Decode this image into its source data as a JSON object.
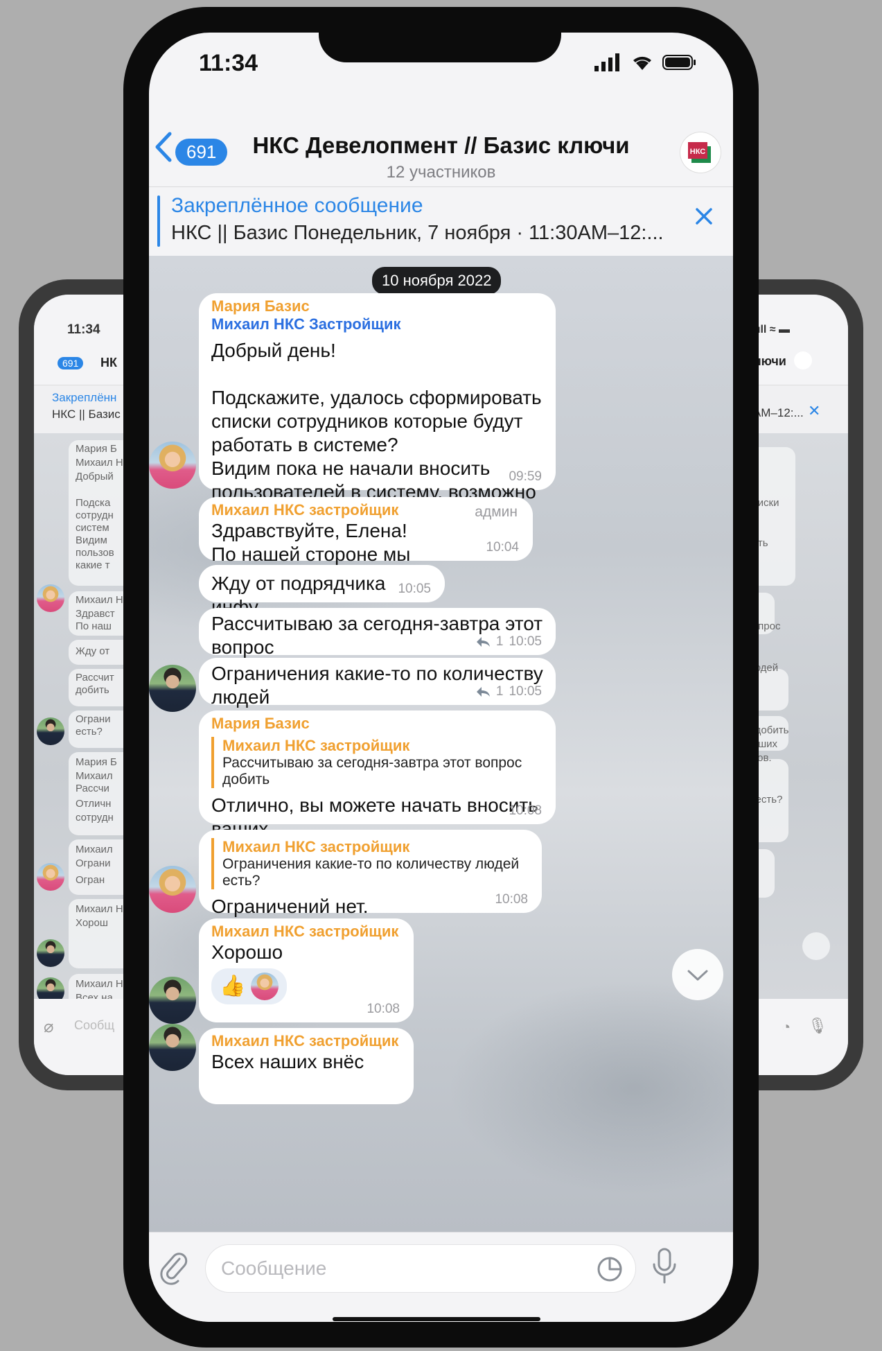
{
  "status": {
    "time": "11:34"
  },
  "header": {
    "badge": "691",
    "title": "НКС Девелопмент // Базис ключи",
    "subtitle": "12 участников",
    "logo_text": "НКС"
  },
  "pinned": {
    "label": "Закреплённое сообщение",
    "text": "НКС || Базис Понедельник, 7 ноября · 11:30AM–12:..."
  },
  "chat": {
    "date": "10 ноября 2022",
    "messages": [
      {
        "sender": "Мария Базис",
        "forward_from": "Михаил НКС Застройщик",
        "text": "Добрый день!\n\nПодскажите, удалось сформировать списки сотрудников которые будут работать в системе?\nВидим пока не начали вносить пользователей в систему, возможно есть какие то трудности  и нужна помощь?",
        "time": "09:59"
      },
      {
        "sender": "Михаил НКС застройщик",
        "role": "админ",
        "text": "Здравствуйте, Елена!\nПо нашей стороне мы определились",
        "time": "10:04"
      },
      {
        "text": "Жду от подрядчика инфу",
        "time": "10:05"
      },
      {
        "text": "Рассчитываю за сегодня-завтра этот вопрос\nдобить",
        "replies": "1",
        "time": "10:05"
      },
      {
        "text": "Ограничения какие-то по количеству людей\nесть?",
        "replies": "1",
        "time": "10:05"
      },
      {
        "sender": "Мария Базис",
        "quote_name": "Михаил НКС застройщик",
        "quote_text": "Рассчитываю за сегодня-завтра этот вопрос добить",
        "text": "Отлично, вы можете начать вносить ваших\nсотрудников, потом внесете подрядчиков.",
        "time": "10:08"
      },
      {
        "quote_name": "Михаил НКС застройщик",
        "quote_text": "Ограничения какие-то по количеству людей есть?",
        "text": "Ограничений нет.",
        "time": "10:08"
      },
      {
        "sender": "Михаил НКС застройщик",
        "text": "Хорошо",
        "reaction": "👍",
        "time": "10:08"
      },
      {
        "sender": "Михаил НКС застройщик",
        "text": "Всех наших внёс"
      }
    ]
  },
  "composer": {
    "placeholder": "Сообщение"
  },
  "back_left": {
    "time": "11:34",
    "badge": "691",
    "title_part": "НК",
    "pin_label": "Закреплённ",
    "pin_text": "НКС || Базис",
    "lines": [
      "Мария Б",
      "Михаил Н",
      "Добрый",
      "Подска",
      "сотрудн",
      "систем",
      "Видим",
      "пользов",
      "какие т",
      "Михаил Н",
      "Здравст",
      "По наш",
      "Жду от",
      "Рассчит",
      "добить",
      "Ограни",
      "есть?",
      "Мария Б",
      "Михаил",
      "Рассчи",
      "Отличн",
      "сотрудн",
      "Михаил",
      "Ограни",
      "Огран",
      "Михаил Н",
      "Хорош",
      "Михаил Н",
      "Всех на"
    ],
    "input": "Сообщ"
  },
  "back_right": {
    "title_part": "ключи",
    "pin_text": "30AM–12:...",
    "lines": [
      "списки",
      "в",
      "есть",
      "?",
      "вопрос",
      "людей",
      "с добить",
      "ваших",
      "иков.",
      "й есть?"
    ]
  },
  "colors": {
    "accent": "#2b86e6",
    "sender": "#f0a030",
    "forward": "#2b6fe0"
  }
}
